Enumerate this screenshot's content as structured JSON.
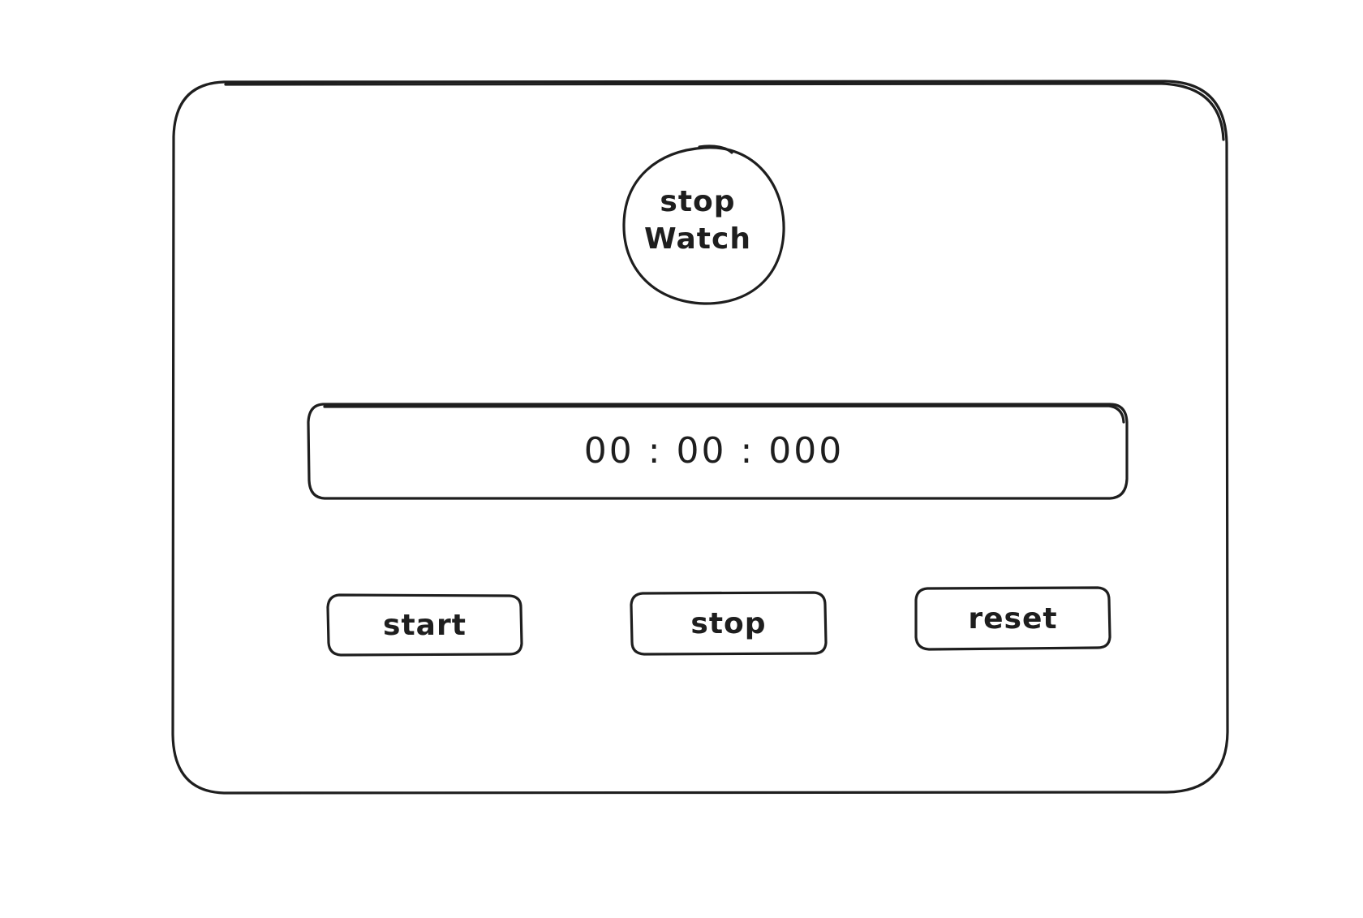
{
  "logo": {
    "line1": "stop",
    "line2": "Watch"
  },
  "timer": {
    "display": "00 : 00 : 000"
  },
  "buttons": {
    "start": "start",
    "stop": "stop",
    "reset": "reset"
  },
  "colors": {
    "stroke": "#1e1e1e",
    "background": "#ffffff"
  }
}
